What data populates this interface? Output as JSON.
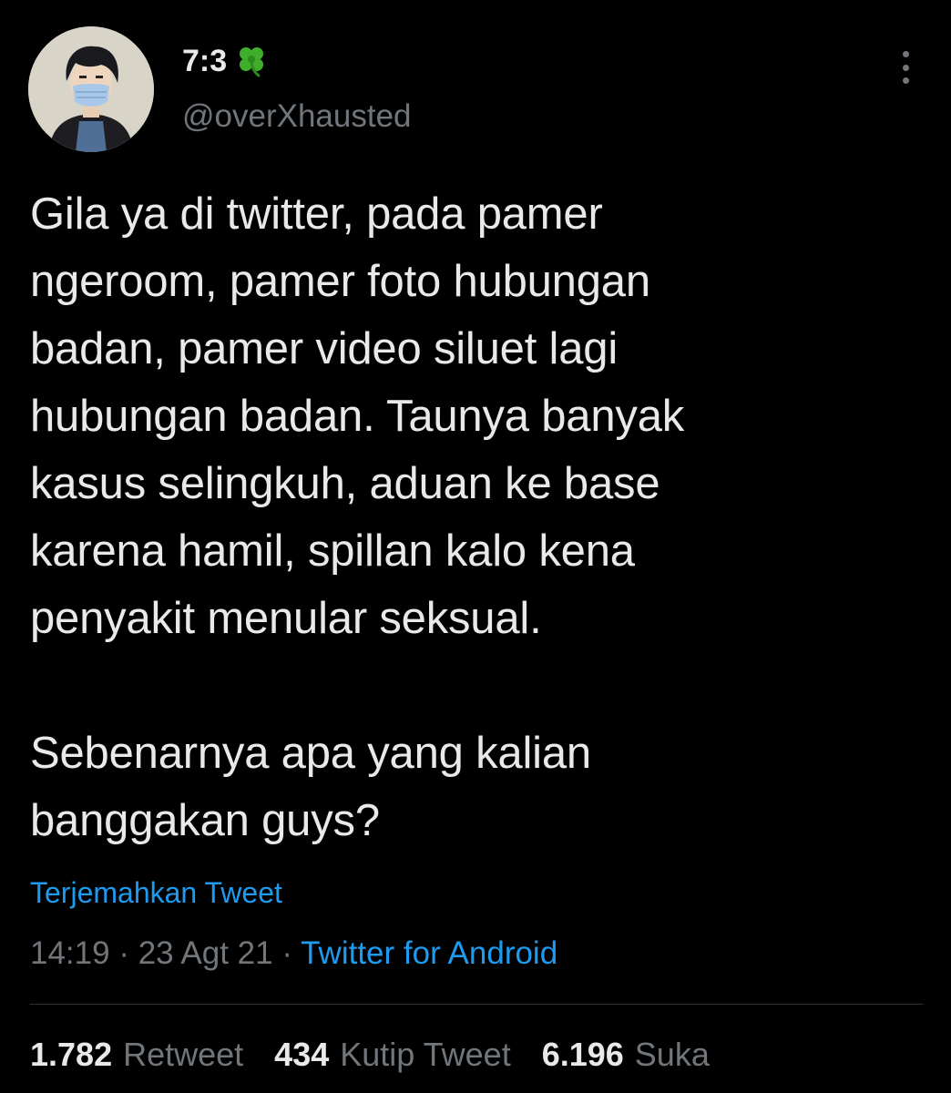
{
  "author": {
    "display_name": "7:3",
    "emoji_icon": "four-leaf-clover-icon",
    "handle": "@overXhausted"
  },
  "tweet": {
    "text": "Gila ya di twitter, pada pamer\nngeroom, pamer foto hubungan\nbadan, pamer video siluet lagi\nhubungan badan. Taunya banyak\nkasus selingkuh, aduan ke base\nkarena hamil, spillan kalo kena\npenyakit menular seksual.\n\nSebenarnya apa yang kalian\nbanggakan guys?",
    "translate_label": "Terjemahkan Tweet",
    "time": "14:19",
    "date": "23 Agt 21",
    "separator": " · ",
    "source": "Twitter for Android"
  },
  "stats": {
    "retweets": {
      "count": "1.782",
      "label": "Retweet"
    },
    "quotes": {
      "count": "434",
      "label": "Kutip Tweet"
    },
    "likes": {
      "count": "6.196",
      "label": "Suka"
    }
  },
  "colors": {
    "background": "#000000",
    "text": "#e7e9ea",
    "muted": "#71767b",
    "accent": "#1d9bf0",
    "divider": "#2f3336",
    "clover": "#3fae2a"
  }
}
